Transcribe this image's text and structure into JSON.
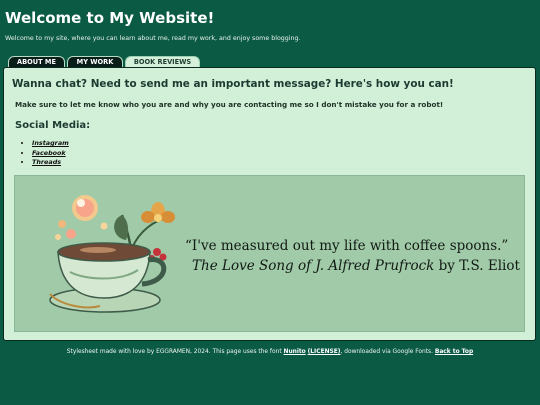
{
  "header": {
    "title": "Welcome to My Website!",
    "subtitle": "Welcome to my site, where you can learn about me, read my work, and enjoy some blogging."
  },
  "tabs": [
    {
      "label": "ABOUT ME",
      "active": false
    },
    {
      "label": "MY WORK",
      "active": false
    },
    {
      "label": "BOOK REVIEWS",
      "active": true
    }
  ],
  "main": {
    "heading": "Wanna chat? Need to send me an important message? Here's how you can!",
    "intro": "Make sure to let me know who you are and why you are contacting me so I don't mistake you for a robot!",
    "social_heading": "Social Media:",
    "social_links": [
      "Instagram",
      "Facebook",
      "Threads"
    ]
  },
  "banner": {
    "quote": "“I've measured out my life with coffee spoons.”",
    "work_title": "The Love Song of J. Alfred Prufrock",
    "by": " by T.S. Eliot",
    "art": "coffee-cup-with-flowers-illustration"
  },
  "footer": {
    "text_before": "Stylesheet made with love by EGGRAMEN, 2024. This page uses the font ",
    "font_name": "Nunito",
    "license": "(LICENSE)",
    "text_after": ", downloaded via Google Fonts. ",
    "back_to_top": "Back to Top"
  },
  "colors": {
    "page_bg": "#0b5a44",
    "panel_bg": "#d2f0d8",
    "banner_bg": "#a0caa8",
    "tab_dark": "#0a1e19"
  }
}
